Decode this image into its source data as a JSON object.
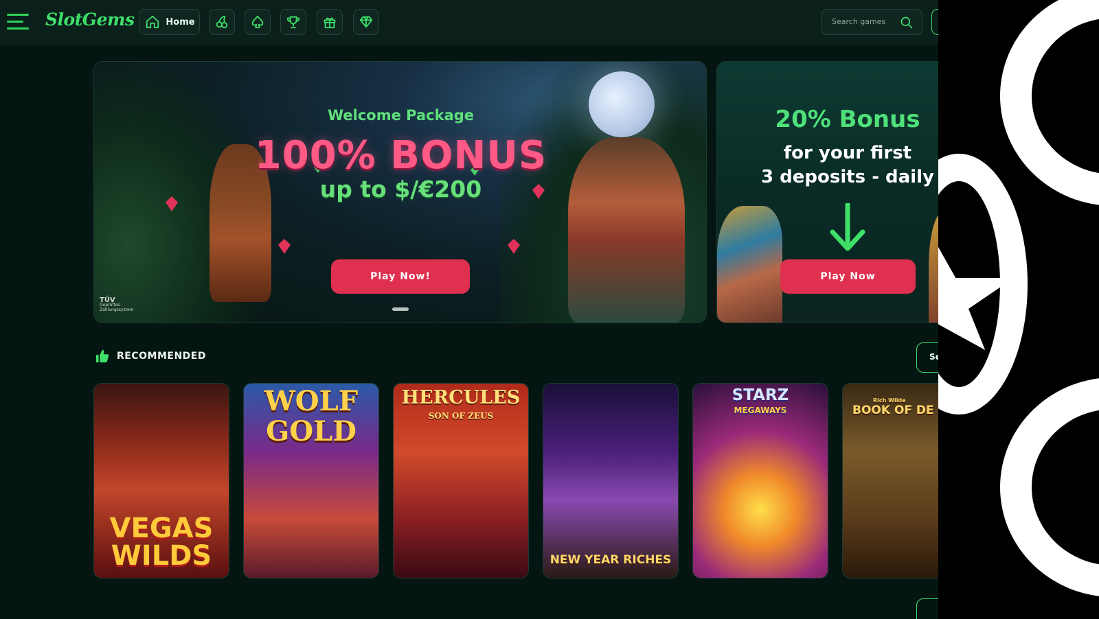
{
  "header": {
    "logo": "SlotGems",
    "nav": [
      {
        "label": "Home",
        "icon": "home-icon"
      },
      {
        "label": "",
        "icon": "cherry-icon"
      },
      {
        "label": "",
        "icon": "spade-icon"
      },
      {
        "label": "",
        "icon": "trophy-icon"
      },
      {
        "label": "",
        "icon": "gift-icon"
      },
      {
        "label": "",
        "icon": "diamond-icon"
      }
    ],
    "search_placeholder": "Search games"
  },
  "banners": {
    "main": {
      "eyebrow": "Welcome Package",
      "headline": "100% BONUS",
      "subline": "up to $/€200",
      "cta": "Play Now!",
      "badge_line1": "TÜV",
      "badge_line2": "Geprüftes Zahlungssystem"
    },
    "side": {
      "headline": "20% Bonus",
      "line1": "for your first",
      "line2": "3 deposits - daily",
      "cta": "Play Now"
    }
  },
  "recommended": {
    "title": "RECOMMENDED",
    "see_all": "Se",
    "games": [
      {
        "name": "VEGAS WILDS"
      },
      {
        "name": "WOLF GOLD"
      },
      {
        "name": "HERCULES",
        "sub": "SON OF ZEUS"
      },
      {
        "name": "NEW YEAR RICHES"
      },
      {
        "name": "STARZ",
        "sub": "MEGAWAYS"
      },
      {
        "name": "BOOK OF DE",
        "small": "Rich Wilde"
      }
    ]
  },
  "colors": {
    "background": "#041512",
    "accent_green": "#3ee06a",
    "cta_red": "#e0304f",
    "bonus_pink": "#ff5a86"
  }
}
